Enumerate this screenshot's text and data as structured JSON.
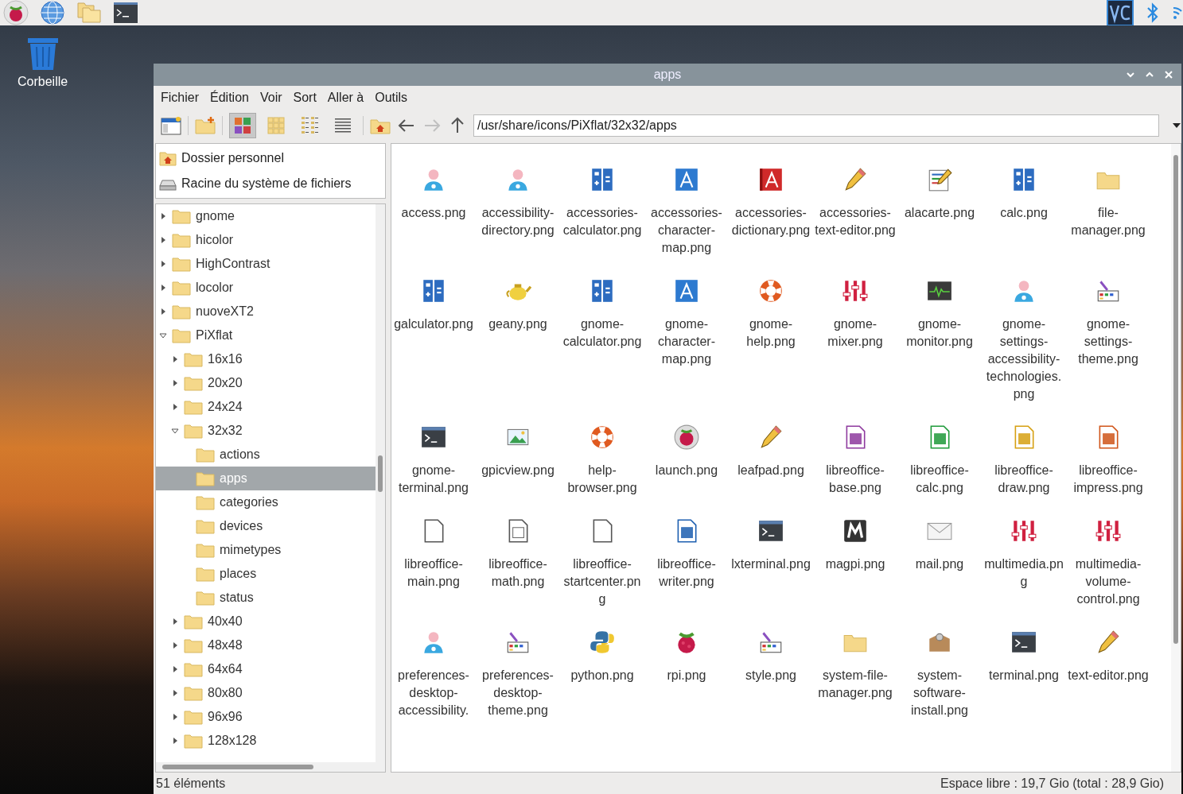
{
  "desktop": {
    "trash_label": "Corbeille"
  },
  "window": {
    "title": "apps"
  },
  "menu": [
    "Fichier",
    "Édition",
    "Voir",
    "Sort",
    "Aller à",
    "Outils"
  ],
  "view_modes": [
    {
      "kind": "icons",
      "selected": true
    },
    {
      "kind": "thumbnails",
      "selected": false
    },
    {
      "kind": "compact",
      "selected": false
    },
    {
      "kind": "list",
      "selected": false
    }
  ],
  "nav": [
    {
      "kind": "back",
      "disabled": false
    },
    {
      "kind": "forward",
      "disabled": true
    },
    {
      "kind": "up",
      "disabled": false
    }
  ],
  "location": "/usr/share/icons/PiXflat/32x32/apps",
  "places": [
    {
      "label": "Dossier personnel",
      "kind": "home"
    },
    {
      "label": "Racine du système de fichiers",
      "kind": "drive"
    }
  ],
  "tree": [
    {
      "label": "gnome",
      "expanded": false,
      "selected": false
    },
    {
      "label": "hicolor",
      "expanded": false,
      "selected": false
    },
    {
      "label": "HighContrast",
      "expanded": false,
      "selected": false
    },
    {
      "label": "locolor",
      "expanded": false,
      "selected": false
    },
    {
      "label": "nuoveXT2",
      "expanded": false,
      "selected": false
    },
    {
      "label": "PiXflat",
      "expanded": true,
      "selected": false,
      "children": [
        {
          "label": "16x16",
          "expanded": false,
          "selected": false
        },
        {
          "label": "20x20",
          "expanded": false,
          "selected": false
        },
        {
          "label": "24x24",
          "expanded": false,
          "selected": false
        },
        {
          "label": "32x32",
          "expanded": true,
          "selected": false,
          "children": [
            {
              "label": "actions",
              "selected": false
            },
            {
              "label": "apps",
              "selected": true
            },
            {
              "label": "categories",
              "selected": false
            },
            {
              "label": "devices",
              "selected": false
            },
            {
              "label": "mimetypes",
              "selected": false
            },
            {
              "label": "places",
              "selected": false
            },
            {
              "label": "status",
              "selected": false
            }
          ]
        },
        {
          "label": "40x40",
          "expanded": false,
          "selected": false
        },
        {
          "label": "48x48",
          "expanded": false,
          "selected": false
        },
        {
          "label": "64x64",
          "expanded": false,
          "selected": false
        },
        {
          "label": "80x80",
          "expanded": false,
          "selected": false
        },
        {
          "label": "96x96",
          "expanded": false,
          "selected": false
        },
        {
          "label": "128x128",
          "expanded": false,
          "selected": false
        }
      ]
    }
  ],
  "files": [
    {
      "name": "access.png",
      "kind": "person"
    },
    {
      "name": "accessibility-directory.png",
      "kind": "person"
    },
    {
      "name": "accessories-calculator.png",
      "kind": "calculator"
    },
    {
      "name": "accessories-character-map.png",
      "kind": "charmap"
    },
    {
      "name": "accessories-dictionary.png",
      "kind": "dictionary"
    },
    {
      "name": "accessories-text-editor.png",
      "kind": "pencil"
    },
    {
      "name": "alacarte.png",
      "kind": "menu-editor"
    },
    {
      "name": "calc.png",
      "kind": "calculator"
    },
    {
      "name": "file-manager.png",
      "kind": "folder"
    },
    {
      "name": "galculator.png",
      "kind": "calculator"
    },
    {
      "name": "geany.png",
      "kind": "teapot"
    },
    {
      "name": "gnome-calculator.png",
      "kind": "calculator"
    },
    {
      "name": "gnome-character-map.png",
      "kind": "charmap"
    },
    {
      "name": "gnome-help.png",
      "kind": "lifebuoy"
    },
    {
      "name": "gnome-mixer.png",
      "kind": "mixer"
    },
    {
      "name": "gnome-monitor.png",
      "kind": "monitor"
    },
    {
      "name": "gnome-settings-accessibility-technologies.png",
      "kind": "person"
    },
    {
      "name": "gnome-settings-theme.png",
      "kind": "palette"
    },
    {
      "name": "gnome-terminal.png",
      "kind": "terminal"
    },
    {
      "name": "gpicview.png",
      "kind": "image"
    },
    {
      "name": "help-browser.png",
      "kind": "lifebuoy"
    },
    {
      "name": "launch.png",
      "kind": "raspberry-badge"
    },
    {
      "name": "leafpad.png",
      "kind": "pencil"
    },
    {
      "name": "libreoffice-base.png",
      "kind": "doc-base"
    },
    {
      "name": "libreoffice-calc.png",
      "kind": "doc-calc"
    },
    {
      "name": "libreoffice-draw.png",
      "kind": "doc-draw"
    },
    {
      "name": "libreoffice-impress.png",
      "kind": "doc-impress"
    },
    {
      "name": "libreoffice-main.png",
      "kind": "doc-blank"
    },
    {
      "name": "libreoffice-math.png",
      "kind": "doc-math"
    },
    {
      "name": "libreoffice-startcenter.png",
      "kind": "doc-blank"
    },
    {
      "name": "libreoffice-writer.png",
      "kind": "doc-writer"
    },
    {
      "name": "lxterminal.png",
      "kind": "terminal"
    },
    {
      "name": "magpi.png",
      "kind": "magpi"
    },
    {
      "name": "mail.png",
      "kind": "mail"
    },
    {
      "name": "multimedia.png",
      "kind": "mixer"
    },
    {
      "name": "multimedia-volume-control.png",
      "kind": "mixer"
    },
    {
      "name": "preferences-desktop-accessibility.",
      "kind": "person"
    },
    {
      "name": "preferences-desktop-theme.png",
      "kind": "palette"
    },
    {
      "name": "python.png",
      "kind": "python"
    },
    {
      "name": "rpi.png",
      "kind": "raspberry"
    },
    {
      "name": "style.png",
      "kind": "palette"
    },
    {
      "name": "system-file-manager.png",
      "kind": "folder"
    },
    {
      "name": "system-software-install.png",
      "kind": "package"
    },
    {
      "name": "terminal.png",
      "kind": "terminal"
    },
    {
      "name": "text-editor.png",
      "kind": "pencil"
    }
  ],
  "status": {
    "count": "51 éléments",
    "free_space": "Espace libre : 19,7 Gio (total : 28,9 Gio)"
  }
}
